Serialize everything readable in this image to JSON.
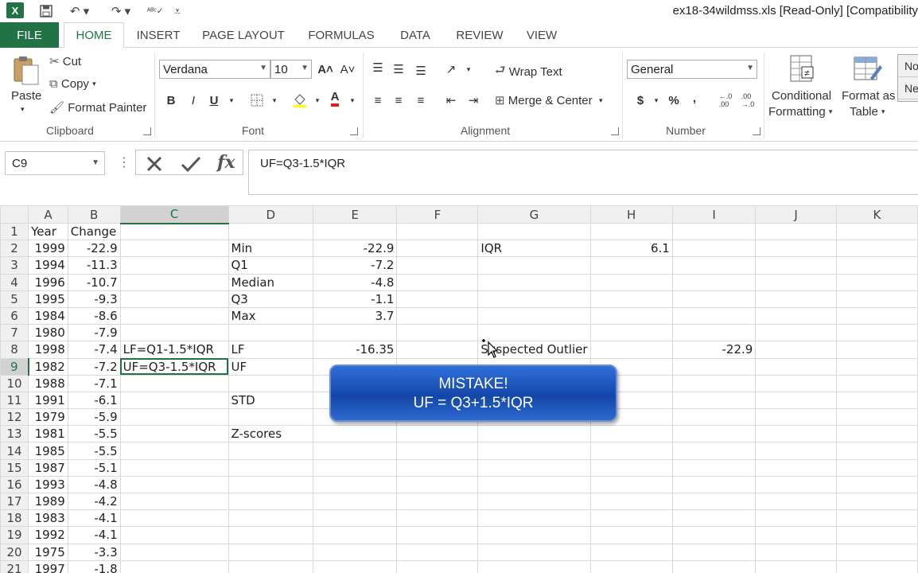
{
  "window": {
    "app_logo": "X",
    "title": "ex18-34wildmss.xls  [Read-Only]  [Compatibility"
  },
  "tabs": [
    {
      "label": "FILE"
    },
    {
      "label": "HOME"
    },
    {
      "label": "INSERT"
    },
    {
      "label": "PAGE LAYOUT"
    },
    {
      "label": "FORMULAS"
    },
    {
      "label": "DATA"
    },
    {
      "label": "REVIEW"
    },
    {
      "label": "VIEW"
    }
  ],
  "ribbon": {
    "clipboard": {
      "paste": "Paste",
      "cut": "Cut",
      "copy": "Copy",
      "format_painter": "Format Painter",
      "label": "Clipboard"
    },
    "font": {
      "name": "Verdana",
      "size": "10",
      "bold": "B",
      "italic": "I",
      "underline": "U",
      "label": "Font"
    },
    "alignment": {
      "wrap_text": "Wrap Text",
      "merge_center": "Merge & Center",
      "label": "Alignment"
    },
    "number": {
      "format": "General",
      "currency": "$",
      "percent": "%",
      "comma": ",",
      "label": "Number"
    },
    "styles": {
      "conditional_formatting_1": "Conditional",
      "conditional_formatting_2": "Formatting",
      "format_as_table_1": "Format as",
      "format_as_table_2": "Table",
      "style_box_1": "No",
      "style_box_2": "Ne"
    }
  },
  "formula_bar": {
    "name_box": "C9",
    "formula": "UF=Q3-1.5*IQR"
  },
  "columns": [
    "A",
    "B",
    "C",
    "D",
    "E",
    "F",
    "G",
    "H",
    "I",
    "J",
    "K"
  ],
  "rows": [
    {
      "n": "1",
      "A": "Year",
      "B": "Change",
      "C": "",
      "D": "",
      "E": "",
      "G": "",
      "H": "",
      "I": ""
    },
    {
      "n": "2",
      "A": "1999",
      "B": "-22.9",
      "C": "",
      "D": "Min",
      "E": "-22.9",
      "G": "IQR",
      "H": "6.1",
      "I": ""
    },
    {
      "n": "3",
      "A": "1994",
      "B": "-11.3",
      "C": "",
      "D": "Q1",
      "E": "-7.2",
      "G": "",
      "H": "",
      "I": ""
    },
    {
      "n": "4",
      "A": "1996",
      "B": "-10.7",
      "C": "",
      "D": "Median",
      "E": "-4.8",
      "G": "",
      "H": "",
      "I": ""
    },
    {
      "n": "5",
      "A": "1995",
      "B": "-9.3",
      "C": "",
      "D": "Q3",
      "E": "-1.1",
      "G": "",
      "H": "",
      "I": ""
    },
    {
      "n": "6",
      "A": "1984",
      "B": "-8.6",
      "C": "",
      "D": "Max",
      "E": "3.7",
      "G": "",
      "H": "",
      "I": ""
    },
    {
      "n": "7",
      "A": "1980",
      "B": "-7.9",
      "C": "",
      "D": "",
      "E": "",
      "G": "",
      "H": "",
      "I": ""
    },
    {
      "n": "8",
      "A": "1998",
      "B": "-7.4",
      "C": "LF=Q1-1.5*IQR",
      "D": "LF",
      "E": "-16.35",
      "G": "Suspected Outlier",
      "H": "",
      "I": "-22.9"
    },
    {
      "n": "9",
      "A": "1982",
      "B": "-7.2",
      "C": "UF=Q3-1.5*IQR",
      "D": "UF",
      "E": "",
      "G": "",
      "H": "",
      "I": ""
    },
    {
      "n": "10",
      "A": "1988",
      "B": "-7.1",
      "C": "",
      "D": "",
      "E": "",
      "G": "",
      "H": "",
      "I": ""
    },
    {
      "n": "11",
      "A": "1991",
      "B": "-6.1",
      "C": "",
      "D": "STD",
      "E": "",
      "G": "",
      "H": "",
      "I": ""
    },
    {
      "n": "12",
      "A": "1979",
      "B": "-5.9",
      "C": "",
      "D": "",
      "E": "",
      "G": "",
      "H": "",
      "I": ""
    },
    {
      "n": "13",
      "A": "1981",
      "B": "-5.5",
      "C": "",
      "D": "Z-scores",
      "E": "",
      "G": "",
      "H": "",
      "I": ""
    },
    {
      "n": "14",
      "A": "1985",
      "B": "-5.5",
      "C": "",
      "D": "",
      "E": "",
      "G": "",
      "H": "",
      "I": ""
    },
    {
      "n": "15",
      "A": "1987",
      "B": "-5.1",
      "C": "",
      "D": "",
      "E": "",
      "G": "",
      "H": "",
      "I": ""
    },
    {
      "n": "16",
      "A": "1993",
      "B": "-4.8",
      "C": "",
      "D": "",
      "E": "",
      "G": "",
      "H": "",
      "I": ""
    },
    {
      "n": "17",
      "A": "1989",
      "B": "-4.2",
      "C": "",
      "D": "",
      "E": "",
      "G": "",
      "H": "",
      "I": ""
    },
    {
      "n": "18",
      "A": "1983",
      "B": "-4.1",
      "C": "",
      "D": "",
      "E": "",
      "G": "",
      "H": "",
      "I": ""
    },
    {
      "n": "19",
      "A": "1992",
      "B": "-4.1",
      "C": "",
      "D": "",
      "E": "",
      "G": "",
      "H": "",
      "I": ""
    },
    {
      "n": "20",
      "A": "1975",
      "B": "-3.3",
      "C": "",
      "D": "",
      "E": "",
      "G": "",
      "H": "",
      "I": ""
    },
    {
      "n": "21",
      "A": "1997",
      "B": "-1.8",
      "C": "",
      "D": "",
      "E": "",
      "G": "",
      "H": "",
      "I": ""
    }
  ],
  "callout": {
    "line1": "MISTAKE!",
    "line2": "UF = Q3+1.5*IQR"
  },
  "colors": {
    "excel_green": "#217346",
    "callout_blue": "#1a4fb3"
  }
}
